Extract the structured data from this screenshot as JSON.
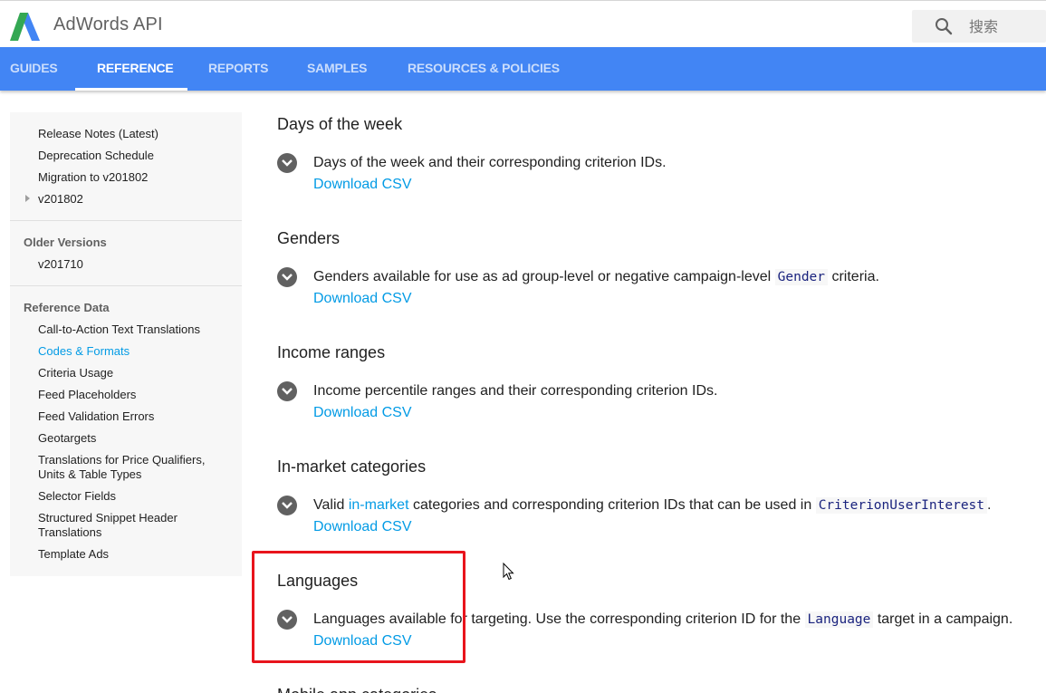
{
  "header": {
    "app_title": "AdWords API",
    "search": {
      "placeholder": "搜索",
      "value": ""
    },
    "logo_icon": "adwords-logo",
    "search_icon": "search-icon"
  },
  "nav": {
    "tabs": [
      {
        "label": "GUIDES",
        "active": false
      },
      {
        "label": "REFERENCE",
        "active": true
      },
      {
        "label": "REPORTS",
        "active": false
      },
      {
        "label": "SAMPLES",
        "active": false
      },
      {
        "label": "RESOURCES & POLICIES",
        "active": false
      }
    ]
  },
  "sidebar": {
    "top_items": [
      "Release Notes (Latest)",
      "Deprecation Schedule",
      "Migration to v201802",
      "v201802"
    ],
    "older_versions": {
      "heading": "Older Versions",
      "items": [
        "v201710"
      ]
    },
    "reference_data": {
      "heading": "Reference Data",
      "items": [
        "Call-to-Action Text Translations",
        "Codes & Formats",
        "Criteria Usage",
        "Feed Placeholders",
        "Feed Validation Errors",
        "Geotargets",
        "Translations for Price Qualifiers,",
        "Units & Table Types",
        "Selector Fields",
        "Structured Snippet Header",
        "Translations",
        "Template Ads"
      ],
      "selected": "Codes & Formats"
    }
  },
  "main": {
    "download_label": "Download CSV",
    "sections": [
      {
        "title": "Days of the week",
        "desc": "Days of the week and their corresponding criterion IDs."
      },
      {
        "title": "Genders",
        "desc_pre": "Genders available for use as ad group-level or negative campaign-level ",
        "desc_code": "Gender",
        "desc_post": " criteria."
      },
      {
        "title": "Income ranges",
        "desc": "Income percentile ranges and their corresponding criterion IDs."
      },
      {
        "title": "In-market categories",
        "desc_pre": "Valid ",
        "desc_link": "in-market",
        "desc_mid": " categories and corresponding criterion IDs that can be used in ",
        "desc_code": "CriterionUserInterest",
        "desc_post": "."
      },
      {
        "title": "Languages",
        "desc_pre": "Languages available for targeting. Use the corresponding criterion ID for the ",
        "desc_code": "Language",
        "desc_post": " target in a campaign."
      },
      {
        "title": "Mobile app categories"
      }
    ]
  },
  "colors": {
    "nav_bg": "#4285f4",
    "link": "#039be5",
    "highlight": "#e8141c"
  }
}
